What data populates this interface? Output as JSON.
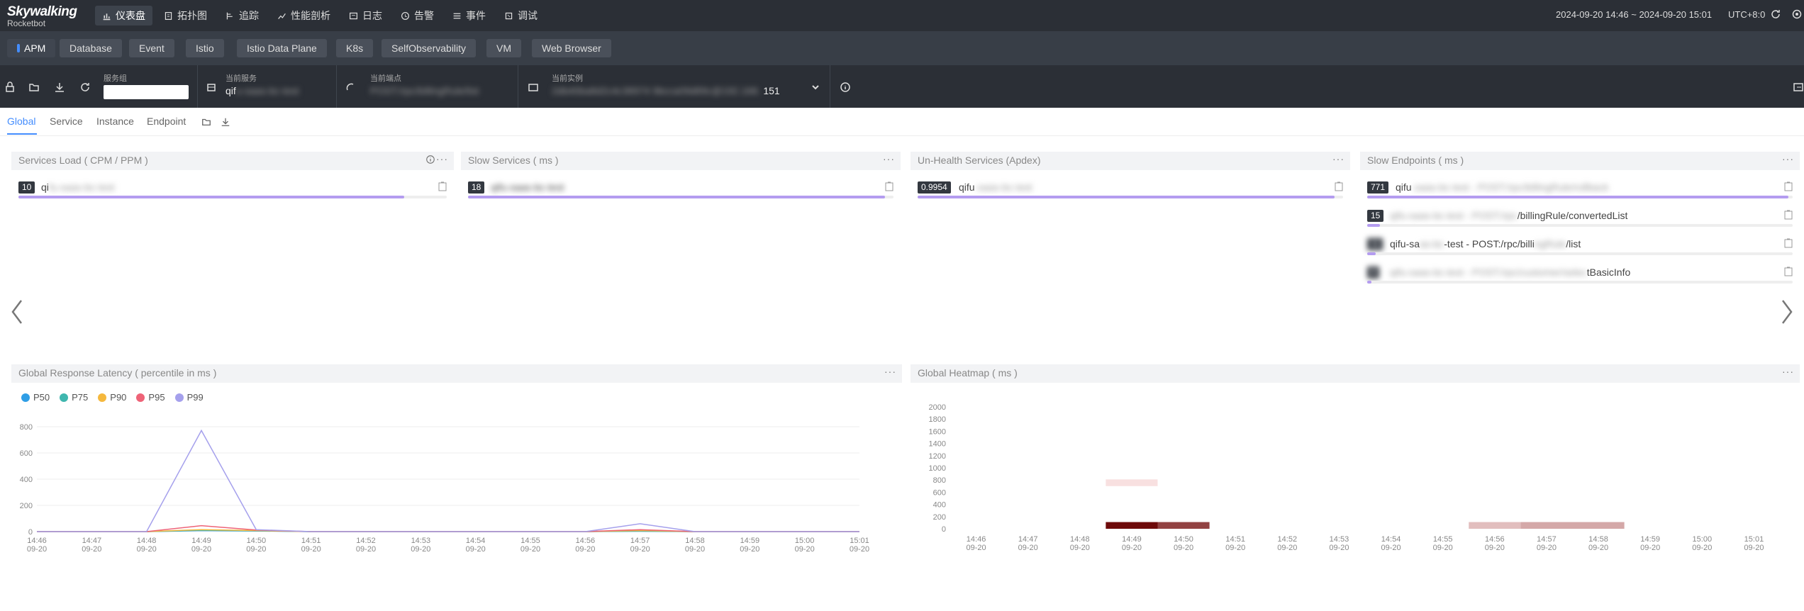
{
  "header": {
    "logo_title": "Skywalking",
    "logo_subtitle": "Rocketbot",
    "nav": [
      {
        "label": "仪表盘",
        "icon": "dashboard-icon",
        "active": true
      },
      {
        "label": "拓扑图",
        "icon": "topology-icon",
        "active": false
      },
      {
        "label": "追踪",
        "icon": "trace-icon",
        "active": false
      },
      {
        "label": "性能剖析",
        "icon": "profile-icon",
        "active": false
      },
      {
        "label": "日志",
        "icon": "log-icon",
        "active": false
      },
      {
        "label": "告警",
        "icon": "alarm-icon",
        "active": false
      },
      {
        "label": "事件",
        "icon": "event-icon",
        "active": false
      },
      {
        "label": "调试",
        "icon": "debug-icon",
        "active": false
      }
    ],
    "time_range": "2024-09-20 14:46 ~ 2024-09-20 15:01",
    "timezone": "UTC+8:0"
  },
  "dashboard_tabs": [
    "APM",
    "Database",
    "Event",
    "Istio",
    "Istio Data Plane",
    "K8s",
    "SelfObservability",
    "VM",
    "Web Browser"
  ],
  "selectors": {
    "group_label": "服务组",
    "group_value": "",
    "service_label": "当前服务",
    "service_value": "qif",
    "service_value_blur": "u-saas-bc-test",
    "endpoint_label": "当前端点",
    "endpoint_value_blur": "POST:/rpc/billingRule/list",
    "instance_label": "当前实例",
    "instance_value_blur": "2db40ba8d2c4c38974 9bcca09d89c@192.168.",
    "instance_value_suffix": "151"
  },
  "subtabs": [
    "Global",
    "Service",
    "Instance",
    "Endpoint"
  ],
  "panels": {
    "services_load": {
      "title": "Services Load ( CPM / PPM )",
      "items": [
        {
          "value": "10",
          "name": "qi",
          "name_blur": "fu-saas-bc-test",
          "fraction": 0.9
        }
      ]
    },
    "slow_services": {
      "title": "Slow Services ( ms )",
      "items": [
        {
          "value": "18",
          "name_blur": "qifu-saas-bc-test",
          "fraction": 0.98
        }
      ]
    },
    "unhealth_services": {
      "title": "Un-Health Services (Apdex)",
      "items": [
        {
          "value": "0.9954",
          "name": "qifu",
          "name_blur": "-saas-bc-test",
          "fraction": 0.98
        }
      ]
    },
    "slow_endpoints": {
      "title": "Slow Endpoints ( ms )",
      "items": [
        {
          "value": "771",
          "name": "qifu",
          "name_blur": "-saas-bc-test - POST:/rpc/billingRule/rollback",
          "fraction": 0.99
        },
        {
          "value": "15",
          "name": "/billingRule/convertedList",
          "name_blur": "qifu-saas-bc-test - POST:/rpc",
          "fraction": 0.03
        },
        {
          "value": "11",
          "name": "qifu-sa",
          "name_blur": "as-bc",
          "name_suffix": "-test - POST:/rpc/billi",
          "name_blur2": "ngRule",
          "name_suffix2": "/list",
          "fraction": 0.02
        },
        {
          "value": "9",
          "name": "tBasicInfo",
          "name_blur": "qifu-saas-bc-test - POST:/rpc/customer/selec",
          "fraction": 0.01
        }
      ]
    },
    "global_latency": {
      "title": "Global Response Latency ( percentile in ms )"
    },
    "global_heatmap": {
      "title": "Global Heatmap ( ms )"
    }
  },
  "chart_data": [
    {
      "type": "line",
      "title": "Global Response Latency ( percentile in ms )",
      "categories": [
        "14:46\n09-20",
        "14:47\n09-20",
        "14:48\n09-20",
        "14:49\n09-20",
        "14:50\n09-20",
        "14:51\n09-20",
        "14:52\n09-20",
        "14:53\n09-20",
        "14:54\n09-20",
        "14:55\n09-20",
        "14:56\n09-20",
        "14:57\n09-20",
        "14:58\n09-20",
        "14:59\n09-20",
        "15:00\n09-20",
        "15:01\n09-20"
      ],
      "x_labels": [
        "14:46",
        "14:47",
        "14:48",
        "14:49",
        "14:50",
        "14:51",
        "14:52",
        "14:53",
        "14:54",
        "14:55",
        "14:56",
        "14:57",
        "14:58",
        "14:59",
        "15:00",
        "15:01"
      ],
      "x_sublabel": "09-20",
      "yticks": [
        0,
        200,
        400,
        600,
        800
      ],
      "ylim": [
        0,
        800
      ],
      "series": [
        {
          "name": "P50",
          "color": "#2f9ee6",
          "values": [
            0,
            0,
            0,
            8,
            5,
            0,
            0,
            0,
            0,
            0,
            0,
            3,
            0,
            0,
            0,
            0
          ]
        },
        {
          "name": "P75",
          "color": "#3fb6ae",
          "values": [
            0,
            0,
            0,
            10,
            6,
            0,
            0,
            0,
            0,
            0,
            0,
            4,
            0,
            0,
            0,
            0
          ]
        },
        {
          "name": "P90",
          "color": "#f5b83d",
          "values": [
            0,
            0,
            0,
            15,
            8,
            0,
            0,
            0,
            0,
            0,
            0,
            8,
            0,
            0,
            0,
            0
          ]
        },
        {
          "name": "P95",
          "color": "#ee6377",
          "values": [
            0,
            0,
            0,
            45,
            12,
            0,
            0,
            0,
            0,
            0,
            0,
            15,
            0,
            0,
            0,
            0
          ]
        },
        {
          "name": "P99",
          "color": "#a5a0ec",
          "values": [
            0,
            0,
            0,
            771,
            15,
            0,
            0,
            0,
            0,
            0,
            0,
            60,
            0,
            0,
            0,
            0
          ]
        }
      ]
    },
    {
      "type": "heatmap",
      "title": "Global Heatmap ( ms )",
      "x_labels": [
        "14:46",
        "14:47",
        "14:48",
        "14:49",
        "14:50",
        "14:51",
        "14:52",
        "14:53",
        "14:54",
        "14:55",
        "14:56",
        "14:57",
        "14:58",
        "14:59",
        "15:00",
        "15:01"
      ],
      "x_sublabel": "09-20",
      "yticks": [
        0,
        200,
        400,
        600,
        800,
        1000,
        1200,
        1400,
        1600,
        1800,
        2000
      ],
      "ylim": [
        0,
        2000
      ],
      "cells": [
        {
          "x": "14:49",
          "y": 0,
          "intensity": 1.0
        },
        {
          "x": "14:50",
          "y": 0,
          "intensity": 0.75
        },
        {
          "x": "14:49",
          "y": 700,
          "intensity": 0.05
        },
        {
          "x": "14:56",
          "y": 0,
          "intensity": 0.2
        },
        {
          "x": "14:57",
          "y": 0,
          "intensity": 0.3
        },
        {
          "x": "14:58",
          "y": 0,
          "intensity": 0.3
        }
      ]
    }
  ]
}
